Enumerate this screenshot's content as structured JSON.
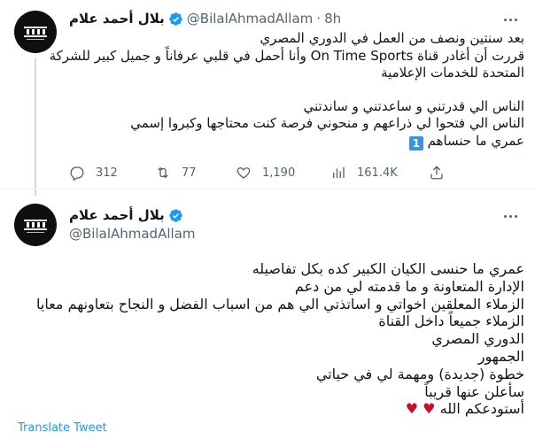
{
  "tweet1": {
    "author_name": "بلال أحمد علام",
    "handle": "@BilalAhmadAllam",
    "separator": "·",
    "time": "8h",
    "lines_para1": [
      "بعد سنتين ونصف من العمل في الدوري المصري",
      "قررت أن أغادر قناة On Time Sports وأنا أحمل في قلبي عرفاناً و جميل كبير للشركة",
      "المتحدة للخدمات الإعلامية"
    ],
    "lines_para2": [
      "الناس الي قدرتني و ساعدتني و ساندتني",
      "الناس الي فتحوا لي ذراعهم و منحوني فرصة كنت محتاجها وكبروا إسمي",
      "عمري ما حنساهم"
    ],
    "badge": "1",
    "stats": {
      "replies": "312",
      "retweets": "77",
      "likes": "1,190",
      "views": "161.4K"
    }
  },
  "tweet2": {
    "author_name": "بلال أحمد علام",
    "handle": "@BilalAhmadAllam",
    "lines": [
      "عمري ما حنسى الكيان الكبير كده بكل تفاصيله",
      "الإدارة المتعاونة و ما قدمته لي من دعم",
      "الزملاء المعلقين اخواتي و اساتذتي الي هم من اسباب الفضل و النجاح بتعاونهم معايا",
      "الزملاء جميعاً داخل القناة",
      "الدوري المصري",
      "الجمهور",
      "خطوة (جديدة) ومهمة لي في حياتي",
      "سأعلن عنها قريباً"
    ],
    "closing": "أستودعكم الله",
    "hearts": "♥ ♥",
    "translate_label": "Translate Tweet"
  },
  "icons": {
    "avatar": "channel-logo",
    "verified": "verified-badge-icon",
    "more": "more-icon",
    "reply": "reply-icon",
    "retweet": "retweet-icon",
    "like": "like-icon",
    "views": "views-icon",
    "share": "share-icon"
  },
  "colors": {
    "accent": "#1d9bf0",
    "muted": "#536471",
    "text": "#0f1419",
    "heart": "#c8102e"
  }
}
